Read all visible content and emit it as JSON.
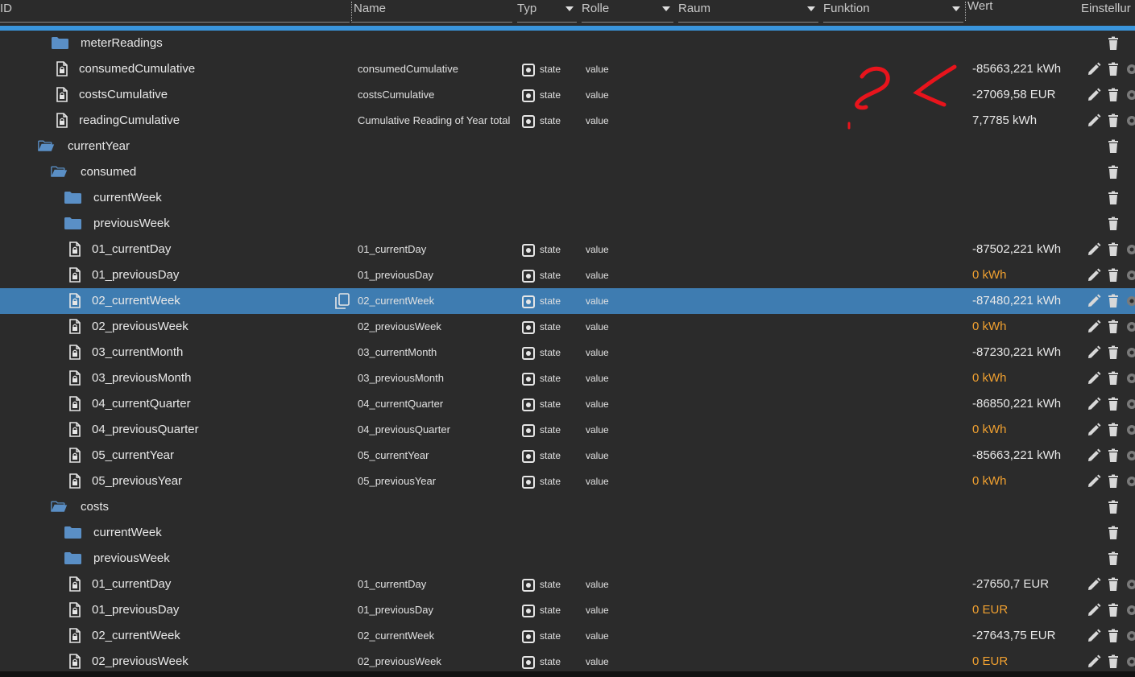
{
  "header": {
    "id": "ID",
    "name": "Name",
    "typ": "Typ",
    "rolle": "Rolle",
    "raum": "Raum",
    "funktion": "Funktion",
    "wert": "Wert",
    "einstellungen": "Einstellur"
  },
  "colors": {
    "accent": "#3a95dc",
    "selected": "#3e7cb1",
    "zero_value": "#f0a030",
    "annotation": "#e8141c"
  },
  "rows": [
    {
      "kind": "folder",
      "indent": 1,
      "id": "meterReadings",
      "name": "",
      "typ": "",
      "rolle": "",
      "wert": ""
    },
    {
      "kind": "file",
      "indent": 1,
      "id": "consumedCumulative",
      "name": "consumedCumulative",
      "typ": "state",
      "rolle": "value",
      "wert": "-85663,221 kWh"
    },
    {
      "kind": "file",
      "indent": 1,
      "id": "costsCumulative",
      "name": "costsCumulative",
      "typ": "state",
      "rolle": "value",
      "wert": "-27069,58 EUR"
    },
    {
      "kind": "file",
      "indent": 1,
      "id": "readingCumulative",
      "name": "Cumulative Reading of Year total",
      "typ": "state",
      "rolle": "value",
      "wert": "7,7785 kWh"
    },
    {
      "kind": "open",
      "indent": 0,
      "id": "currentYear",
      "name": "",
      "typ": "",
      "rolle": "",
      "wert": ""
    },
    {
      "kind": "open",
      "indent": 1,
      "id": "consumed",
      "name": "",
      "typ": "",
      "rolle": "",
      "wert": ""
    },
    {
      "kind": "folder",
      "indent": 2,
      "id": "currentWeek",
      "name": "",
      "typ": "",
      "rolle": "",
      "wert": ""
    },
    {
      "kind": "folder",
      "indent": 2,
      "id": "previousWeek",
      "name": "",
      "typ": "",
      "rolle": "",
      "wert": ""
    },
    {
      "kind": "file",
      "indent": 2,
      "id": "01_currentDay",
      "name": "01_currentDay",
      "typ": "state",
      "rolle": "value",
      "wert": "-87502,221 kWh"
    },
    {
      "kind": "file",
      "indent": 2,
      "id": "01_previousDay",
      "name": "01_previousDay",
      "typ": "state",
      "rolle": "value",
      "wert": "0 kWh",
      "zero": true
    },
    {
      "kind": "file",
      "indent": 2,
      "id": "02_currentWeek",
      "name": "02_currentWeek",
      "typ": "state",
      "rolle": "value",
      "wert": "-87480,221 kWh",
      "selected": true
    },
    {
      "kind": "file",
      "indent": 2,
      "id": "02_previousWeek",
      "name": "02_previousWeek",
      "typ": "state",
      "rolle": "value",
      "wert": "0 kWh",
      "zero": true
    },
    {
      "kind": "file",
      "indent": 2,
      "id": "03_currentMonth",
      "name": "03_currentMonth",
      "typ": "state",
      "rolle": "value",
      "wert": "-87230,221 kWh"
    },
    {
      "kind": "file",
      "indent": 2,
      "id": "03_previousMonth",
      "name": "03_previousMonth",
      "typ": "state",
      "rolle": "value",
      "wert": "0 kWh",
      "zero": true
    },
    {
      "kind": "file",
      "indent": 2,
      "id": "04_currentQuarter",
      "name": "04_currentQuarter",
      "typ": "state",
      "rolle": "value",
      "wert": "-86850,221 kWh"
    },
    {
      "kind": "file",
      "indent": 2,
      "id": "04_previousQuarter",
      "name": "04_previousQuarter",
      "typ": "state",
      "rolle": "value",
      "wert": "0 kWh",
      "zero": true
    },
    {
      "kind": "file",
      "indent": 2,
      "id": "05_currentYear",
      "name": "05_currentYear",
      "typ": "state",
      "rolle": "value",
      "wert": "-85663,221 kWh"
    },
    {
      "kind": "file",
      "indent": 2,
      "id": "05_previousYear",
      "name": "05_previousYear",
      "typ": "state",
      "rolle": "value",
      "wert": "0 kWh",
      "zero": true
    },
    {
      "kind": "open",
      "indent": 1,
      "id": "costs",
      "name": "",
      "typ": "",
      "rolle": "",
      "wert": ""
    },
    {
      "kind": "folder",
      "indent": 2,
      "id": "currentWeek",
      "name": "",
      "typ": "",
      "rolle": "",
      "wert": ""
    },
    {
      "kind": "folder",
      "indent": 2,
      "id": "previousWeek",
      "name": "",
      "typ": "",
      "rolle": "",
      "wert": ""
    },
    {
      "kind": "file",
      "indent": 2,
      "id": "01_currentDay",
      "name": "01_currentDay",
      "typ": "state",
      "rolle": "value",
      "wert": "-27650,7 EUR"
    },
    {
      "kind": "file",
      "indent": 2,
      "id": "01_previousDay",
      "name": "01_previousDay",
      "typ": "state",
      "rolle": "value",
      "wert": "0 EUR",
      "zero": true
    },
    {
      "kind": "file",
      "indent": 2,
      "id": "02_currentWeek",
      "name": "02_currentWeek",
      "typ": "state",
      "rolle": "value",
      "wert": "-27643,75 EUR"
    },
    {
      "kind": "file",
      "indent": 2,
      "id": "02_previousWeek",
      "name": "02_previousWeek",
      "typ": "state",
      "rolle": "value",
      "wert": "0 EUR",
      "zero": true
    }
  ]
}
